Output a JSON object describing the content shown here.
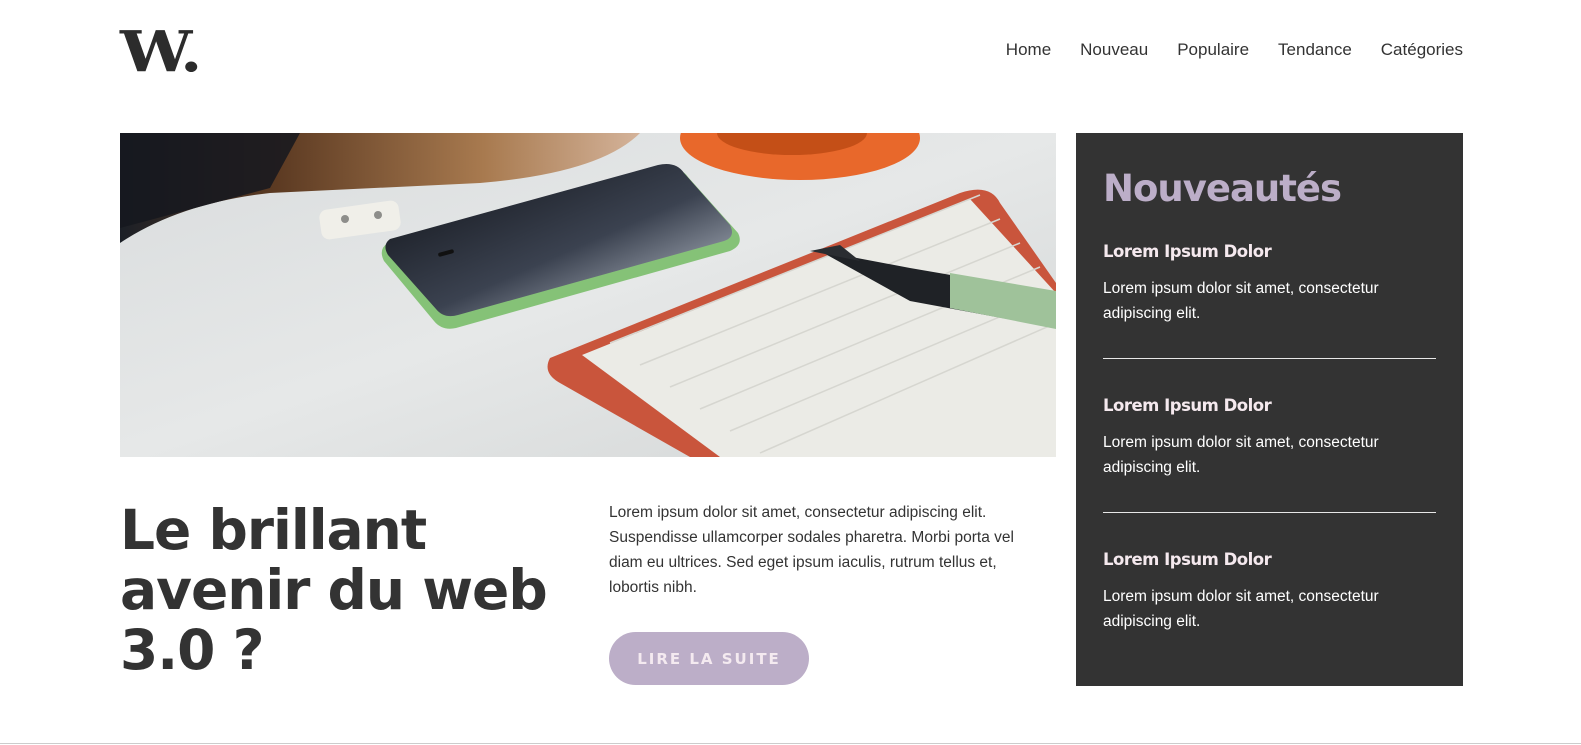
{
  "logo": {
    "text": "W."
  },
  "nav": {
    "items": [
      {
        "label": "Home"
      },
      {
        "label": "Nouveau"
      },
      {
        "label": "Populaire"
      },
      {
        "label": "Tendance"
      },
      {
        "label": "Catégories"
      }
    ]
  },
  "article": {
    "title": "Le brillant avenir du web 3.0 ?",
    "excerpt": "Lorem ipsum dolor sit amet, consectetur adipiscing elit. Suspendisse ullamcorper sodales pharetra. Morbi porta vel diam eu ultrices. Sed eget ipsum iaculis, rutrum tellus et, lobortis nibh.",
    "cta_label": "LIRE LA SUITE"
  },
  "sidebar": {
    "title": "Nouveautés",
    "items": [
      {
        "title": "Lorem Ipsum Dolor",
        "text": "Lorem ipsum dolor sit amet, consectetur adipiscing elit."
      },
      {
        "title": "Lorem Ipsum Dolor",
        "text": "Lorem ipsum dolor sit amet, consectetur adipiscing elit."
      },
      {
        "title": "Lorem Ipsum Dolor",
        "text": "Lorem ipsum dolor sit amet, consectetur adipiscing elit."
      }
    ]
  },
  "colors": {
    "accent": "#bcaec8",
    "sidebar_bg": "#333333",
    "text": "#333333",
    "headline_item": "#f5e9ee"
  }
}
